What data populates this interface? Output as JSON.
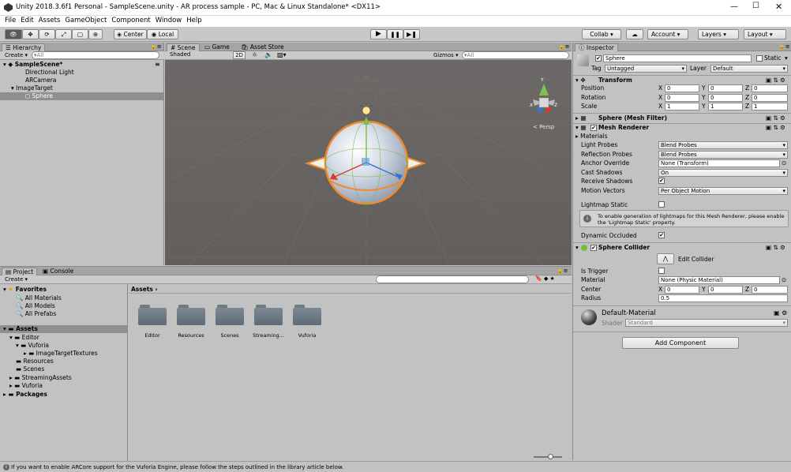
{
  "window": {
    "title": "Unity 2018.3.6f1 Personal - SampleScene.unity - AR   process sample - PC, Mac & Linux Standalone* <DX11>"
  },
  "menu": [
    "File",
    "Edit",
    "Assets",
    "GameObject",
    "Component",
    "Window",
    "Help"
  ],
  "toolbar": {
    "center": "Center",
    "local": "Local",
    "collab": "Collab ▾",
    "account": "Account",
    "layers": "Layers",
    "layout": "Layout"
  },
  "hierarchy": {
    "tab": "Hierarchy",
    "create": "Create ▾",
    "search": "▾All",
    "scene": "SampleScene*",
    "items": [
      "Directional Light",
      "ARCamera",
      "ImageTarget",
      "Sphere"
    ]
  },
  "scene": {
    "tabs": [
      "Scene",
      "Game",
      "Asset Store"
    ],
    "shaded": "Shaded",
    "mode2d": "2D",
    "gizmos": "Gizmos ▾",
    "search": "▾All",
    "persp": "< Persp"
  },
  "project": {
    "tabs": [
      "Project",
      "Console"
    ],
    "create": "Create ▾",
    "favorites": "Favorites",
    "fav_items": [
      "All Materials",
      "All Models",
      "All Prefabs"
    ],
    "assets": "Assets",
    "tree": [
      "Editor",
      "Vuforia",
      "ImageTargetTextures",
      "Resources",
      "Scenes",
      "StreamingAssets",
      "Vuforia"
    ],
    "packages": "Packages",
    "breadcrumb": "Assets",
    "folders": [
      "Editor",
      "Resources",
      "Scenes",
      "Streaming...",
      "Vuforia"
    ]
  },
  "inspector": {
    "tab": "Inspector",
    "name": "Sphere",
    "static": "Static",
    "tag_label": "Tag",
    "tag": "Untagged",
    "layer_label": "Layer",
    "layer": "Default",
    "transform": {
      "title": "Transform",
      "position": "Position",
      "rotation": "Rotation",
      "scale": "Scale",
      "pos": [
        "0",
        "0",
        "0"
      ],
      "rot": [
        "0",
        "0",
        "0"
      ],
      "scl": [
        "1",
        "1",
        "1"
      ]
    },
    "mesh_filter": "Sphere (Mesh Filter)",
    "mesh_renderer": {
      "title": "Mesh Renderer",
      "materials": "Materials",
      "light_probes": "Light Probes",
      "light_probes_v": "Blend Probes",
      "reflection_probes": "Reflection Probes",
      "reflection_probes_v": "Blend Probes",
      "anchor": "Anchor Override",
      "anchor_v": "None (Transform)",
      "cast": "Cast Shadows",
      "cast_v": "On",
      "receive": "Receive Shadows",
      "motion": "Motion Vectors",
      "motion_v": "Per Object Motion",
      "lightmap": "Lightmap Static",
      "info": "To enable generation of lightmaps for this Mesh Renderer, please enable the 'Lightmap Static' property.",
      "dynamic": "Dynamic Occluded"
    },
    "collider": {
      "title": "Sphere Collider",
      "edit": "Edit Collider",
      "trigger": "Is Trigger",
      "material": "Material",
      "material_v": "None (Physic Material)",
      "center": "Center",
      "center_v": [
        "0",
        "0",
        "0"
      ],
      "radius": "Radius",
      "radius_v": "0.5"
    },
    "material": {
      "name": "Default-Material",
      "shader_label": "Shader",
      "shader": "Standard"
    },
    "add_component": "Add Component"
  },
  "status": {
    "message": "If you want to enable ARCore support for the Vuforia Engine, please follow the steps outlined in the library article below."
  },
  "axis": {
    "x": "X",
    "y": "Y",
    "z": "Z"
  }
}
